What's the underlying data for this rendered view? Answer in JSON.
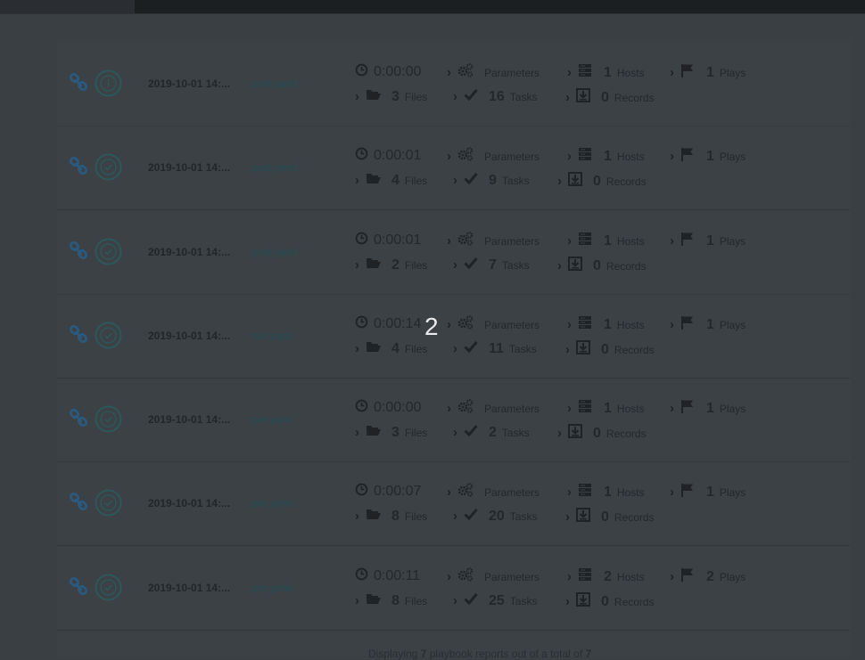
{
  "rows": [
    {
      "status": "info",
      "date": "2019-10-01 14:...",
      "file": "post.yaml",
      "duration": "0:00:00",
      "parameters": "Parameters",
      "hosts": "1",
      "plays": "1",
      "files": "3",
      "tasks": "16",
      "records": "0"
    },
    {
      "status": "ok",
      "date": "2019-10-01 14:...",
      "file": "post.yaml",
      "duration": "0:00:01",
      "parameters": "Parameters",
      "hosts": "1",
      "plays": "1",
      "files": "4",
      "tasks": "9",
      "records": "0"
    },
    {
      "status": "ok",
      "date": "2019-10-01 14:...",
      "file": "post.yaml",
      "duration": "0:00:01",
      "parameters": "Parameters",
      "hosts": "1",
      "plays": "1",
      "files": "2",
      "tasks": "7",
      "records": "0"
    },
    {
      "status": "ok",
      "date": "2019-10-01 14:...",
      "file": "run.yaml",
      "duration": "0:00:14",
      "parameters": "Parameters",
      "hosts": "1",
      "plays": "1",
      "files": "4",
      "tasks": "11",
      "records": "0"
    },
    {
      "status": "ok",
      "date": "2019-10-01 14:...",
      "file": "pre.yaml",
      "duration": "0:00:00",
      "parameters": "Parameters",
      "hosts": "1",
      "plays": "1",
      "files": "3",
      "tasks": "2",
      "records": "0"
    },
    {
      "status": "ok",
      "date": "2019-10-01 14:...",
      "file": "pre.yaml",
      "duration": "0:00:07",
      "parameters": "Parameters",
      "hosts": "1",
      "plays": "1",
      "files": "8",
      "tasks": "20",
      "records": "0"
    },
    {
      "status": "ok",
      "date": "2019-10-01 14:...",
      "file": "pre.yaml",
      "duration": "0:00:11",
      "parameters": "Parameters",
      "hosts": "2",
      "plays": "2",
      "files": "8",
      "tasks": "25",
      "records": "0"
    }
  ],
  "labels": {
    "hosts": "Hosts",
    "plays": "Plays",
    "files": "Files",
    "tasks": "Tasks",
    "records": "Records"
  },
  "overlay_number": "2",
  "footer": {
    "prefix": "Displaying",
    "shown": "7",
    "middle": "playbook reports out of a total of",
    "total": "7"
  }
}
